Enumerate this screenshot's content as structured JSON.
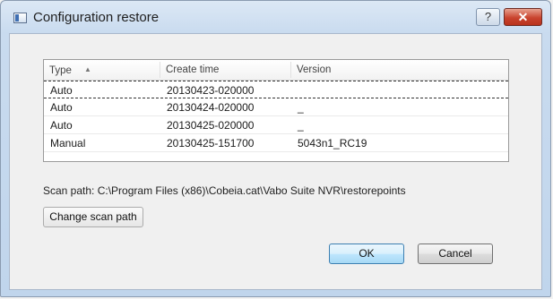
{
  "window": {
    "title": "Configuration restore",
    "help_glyph": "?",
    "close_glyph": "✕"
  },
  "table": {
    "columns": [
      "Type",
      "Create time",
      "Version"
    ],
    "rows": [
      {
        "type": "Auto",
        "create_time": "20130423-020000",
        "version": ""
      },
      {
        "type": "Auto",
        "create_time": "20130424-020000",
        "version": "_"
      },
      {
        "type": "Auto",
        "create_time": "20130425-020000",
        "version": "_"
      },
      {
        "type": "Manual",
        "create_time": "20130425-151700",
        "version": "5043n1_RC19"
      }
    ],
    "selected_row": 0
  },
  "scan_path": {
    "label": "Scan path:",
    "value": "C:\\Program Files (x86)\\Cobeia.cat\\Vabo Suite NVR\\restorepoints"
  },
  "buttons": {
    "change_scan_path": "Change scan path",
    "ok": "OK",
    "cancel": "Cancel"
  },
  "colors": {
    "titlebar": "#c9dbef",
    "close_button": "#c9442e",
    "dialog_background": "#f0f0f0"
  }
}
